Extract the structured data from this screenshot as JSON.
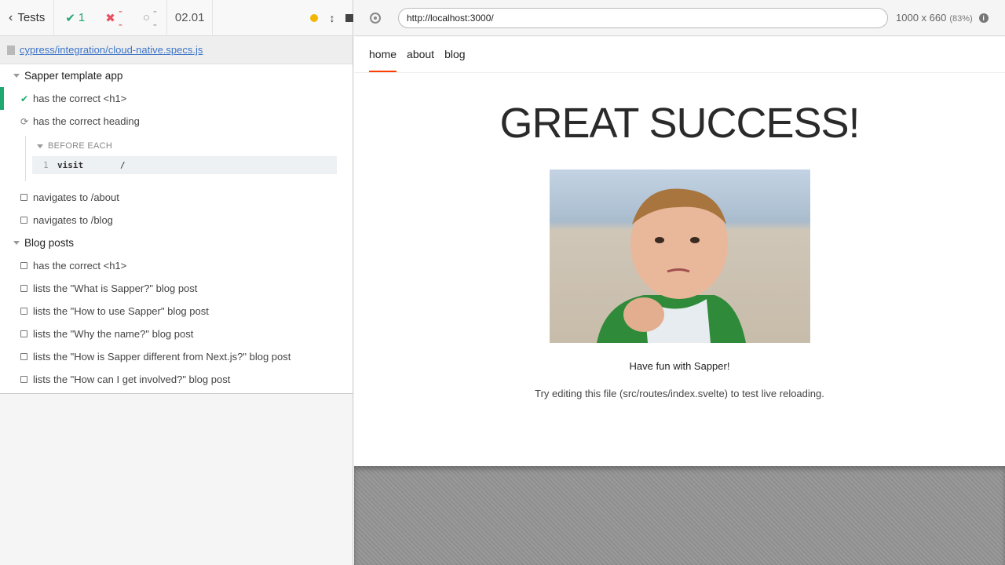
{
  "reporter": {
    "tests_label": "Tests",
    "stats": {
      "passed": "1",
      "failed": "--",
      "pending": "--"
    },
    "duration": "02.01",
    "spec_path": "cypress/integration/cloud-native.specs.js"
  },
  "suites": [
    {
      "title": "Sapper template app",
      "tests": [
        {
          "title": "has the correct <h1>",
          "state": "passed"
        },
        {
          "title": "has the correct heading",
          "state": "running"
        },
        {
          "title": "navigates to /about",
          "state": "pending"
        },
        {
          "title": "navigates to /blog",
          "state": "pending"
        }
      ]
    },
    {
      "title": "Blog posts",
      "tests": [
        {
          "title": "has the correct <h1>",
          "state": "pending"
        },
        {
          "title": "lists the \"What is Sapper?\" blog post",
          "state": "pending"
        },
        {
          "title": "lists the \"How to use Sapper\" blog post",
          "state": "pending"
        },
        {
          "title": "lists the \"Why the name?\" blog post",
          "state": "pending"
        },
        {
          "title": "lists the \"How is Sapper different from Next.js?\" blog post",
          "state": "pending"
        },
        {
          "title": "lists the \"How can I get involved?\" blog post",
          "state": "pending"
        }
      ]
    }
  ],
  "hook": {
    "title": "BEFORE EACH",
    "command": {
      "num": "1",
      "name": "visit",
      "message": "/"
    }
  },
  "aut": {
    "url": "http://localhost:3000/",
    "viewport": "1000 x 660",
    "scale": "(83%)",
    "nav": [
      "home",
      "about",
      "blog"
    ],
    "heading": "GREAT SUCCESS!",
    "caption": "Have fun with Sapper!",
    "hint": "Try editing this file (src/routes/index.svelte) to test live reloading."
  },
  "colors": {
    "passed": "#1fa971",
    "failed": "#e94f5f",
    "accent": "#ff3e00",
    "link": "#3c74c7"
  }
}
